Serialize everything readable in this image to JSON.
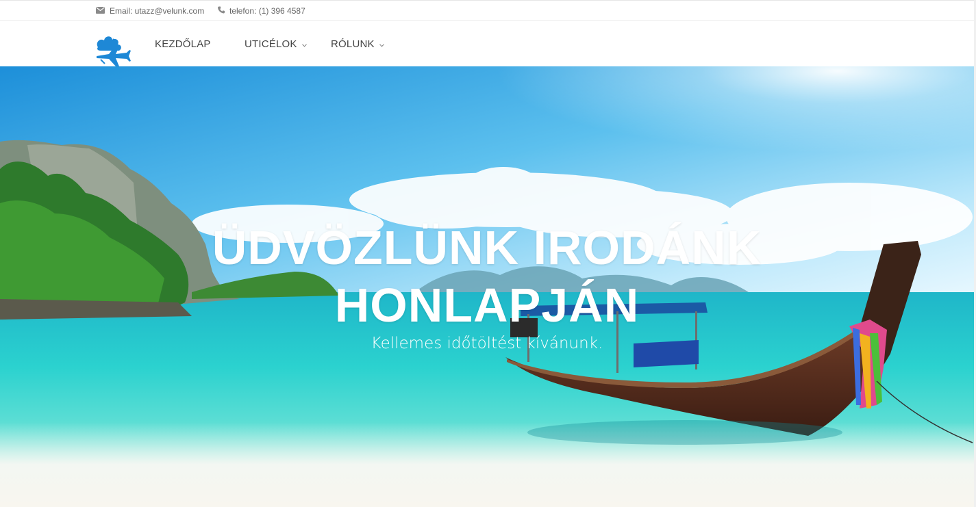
{
  "topbar": {
    "email": {
      "icon": "envelope-icon",
      "text": "Email: utazz@velunk.com"
    },
    "phone": {
      "icon": "phone-icon",
      "text": "telefon: (1) 396 4587"
    }
  },
  "nav": {
    "logo": "plane-cloud-logo",
    "items": [
      {
        "label": "KEZDŐLAP",
        "has_dropdown": false
      },
      {
        "label": "UTICÉLOK",
        "has_dropdown": true
      },
      {
        "label": "RÓLUNK",
        "has_dropdown": true
      }
    ]
  },
  "hero": {
    "title_line1": "ÜDVÖZLÜNK IRODÁNK",
    "title_line2": "HONLAPJÁN",
    "subtitle": "Kellemes időtöltést kívánunk."
  },
  "colors": {
    "logo_blue": "#1e88d6",
    "sea": "#2fd0cf",
    "sky": "#3aa9e6",
    "nav_text": "#444444"
  }
}
